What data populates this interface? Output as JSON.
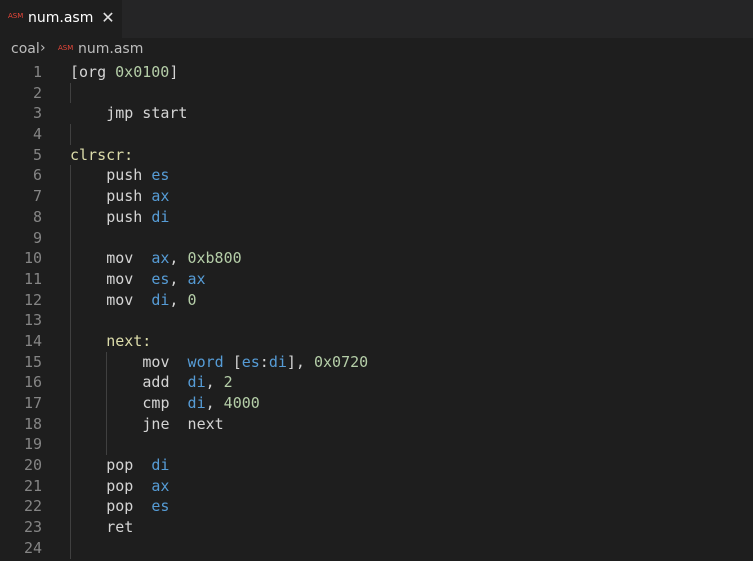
{
  "tab": {
    "icon_text": "ASM",
    "label": "num.asm",
    "close_glyph": "✕"
  },
  "breadcrumb": {
    "folder": "coal",
    "separator": "›",
    "icon_text": "ASM",
    "file": "num.asm"
  },
  "colors": {
    "background": "#1e1e1e",
    "default_text": "#d4d4d4",
    "number": "#b5cea8",
    "register": "#569cd6",
    "label": "#dcdcaa",
    "line_number": "#858585"
  },
  "code_lines": [
    {
      "n": "1",
      "indent": 0,
      "guides": [],
      "tokens": [
        [
          "[org ",
          "default"
        ],
        [
          "0x0100",
          "num"
        ],
        [
          "]",
          "default"
        ]
      ]
    },
    {
      "n": "2",
      "indent": 0,
      "guides": [
        1
      ],
      "tokens": []
    },
    {
      "n": "3",
      "indent": 1,
      "guides": [],
      "tokens": [
        [
          "jmp start",
          "default"
        ]
      ]
    },
    {
      "n": "4",
      "indent": 0,
      "guides": [
        1
      ],
      "tokens": []
    },
    {
      "n": "5",
      "indent": 0,
      "guides": [],
      "tokens": [
        [
          "clrscr:",
          "label"
        ]
      ]
    },
    {
      "n": "6",
      "indent": 1,
      "guides": [
        1
      ],
      "tokens": [
        [
          "push ",
          "default"
        ],
        [
          "es",
          "reg"
        ]
      ]
    },
    {
      "n": "7",
      "indent": 1,
      "guides": [
        1
      ],
      "tokens": [
        [
          "push ",
          "default"
        ],
        [
          "ax",
          "reg"
        ]
      ]
    },
    {
      "n": "8",
      "indent": 1,
      "guides": [
        1
      ],
      "tokens": [
        [
          "push ",
          "default"
        ],
        [
          "di",
          "reg"
        ]
      ]
    },
    {
      "n": "9",
      "indent": 0,
      "guides": [
        1
      ],
      "tokens": []
    },
    {
      "n": "10",
      "indent": 1,
      "guides": [
        1
      ],
      "tokens": [
        [
          "mov  ",
          "default"
        ],
        [
          "ax",
          "reg"
        ],
        [
          ", ",
          "default"
        ],
        [
          "0xb800",
          "num"
        ]
      ]
    },
    {
      "n": "11",
      "indent": 1,
      "guides": [
        1
      ],
      "tokens": [
        [
          "mov  ",
          "default"
        ],
        [
          "es",
          "reg"
        ],
        [
          ", ",
          "default"
        ],
        [
          "ax",
          "reg"
        ]
      ]
    },
    {
      "n": "12",
      "indent": 1,
      "guides": [
        1
      ],
      "tokens": [
        [
          "mov  ",
          "default"
        ],
        [
          "di",
          "reg"
        ],
        [
          ", ",
          "default"
        ],
        [
          "0",
          "num"
        ]
      ]
    },
    {
      "n": "13",
      "indent": 0,
      "guides": [
        1
      ],
      "tokens": []
    },
    {
      "n": "14",
      "indent": 1,
      "guides": [
        1
      ],
      "tokens": [
        [
          "next:",
          "label"
        ]
      ]
    },
    {
      "n": "15",
      "indent": 2,
      "guides": [
        1,
        2
      ],
      "tokens": [
        [
          "mov  ",
          "default"
        ],
        [
          "word",
          "reg"
        ],
        [
          " [",
          "default"
        ],
        [
          "es",
          "reg"
        ],
        [
          ":",
          "default"
        ],
        [
          "di",
          "reg"
        ],
        [
          "], ",
          "default"
        ],
        [
          "0x0720",
          "num"
        ]
      ]
    },
    {
      "n": "16",
      "indent": 2,
      "guides": [
        1,
        2
      ],
      "tokens": [
        [
          "add  ",
          "default"
        ],
        [
          "di",
          "reg"
        ],
        [
          ", ",
          "default"
        ],
        [
          "2",
          "num"
        ]
      ]
    },
    {
      "n": "17",
      "indent": 2,
      "guides": [
        1,
        2
      ],
      "tokens": [
        [
          "cmp  ",
          "default"
        ],
        [
          "di",
          "reg"
        ],
        [
          ", ",
          "default"
        ],
        [
          "4000",
          "num"
        ]
      ]
    },
    {
      "n": "18",
      "indent": 2,
      "guides": [
        1,
        2
      ],
      "tokens": [
        [
          "jne  next",
          "default"
        ]
      ]
    },
    {
      "n": "19",
      "indent": 0,
      "guides": [
        1,
        2
      ],
      "tokens": []
    },
    {
      "n": "20",
      "indent": 1,
      "guides": [
        1
      ],
      "tokens": [
        [
          "pop  ",
          "default"
        ],
        [
          "di",
          "reg"
        ]
      ]
    },
    {
      "n": "21",
      "indent": 1,
      "guides": [
        1
      ],
      "tokens": [
        [
          "pop  ",
          "default"
        ],
        [
          "ax",
          "reg"
        ]
      ]
    },
    {
      "n": "22",
      "indent": 1,
      "guides": [
        1
      ],
      "tokens": [
        [
          "pop  ",
          "default"
        ],
        [
          "es",
          "reg"
        ]
      ]
    },
    {
      "n": "23",
      "indent": 1,
      "guides": [
        1
      ],
      "tokens": [
        [
          "ret",
          "default"
        ]
      ]
    },
    {
      "n": "24",
      "indent": 0,
      "guides": [
        1
      ],
      "tokens": []
    }
  ]
}
